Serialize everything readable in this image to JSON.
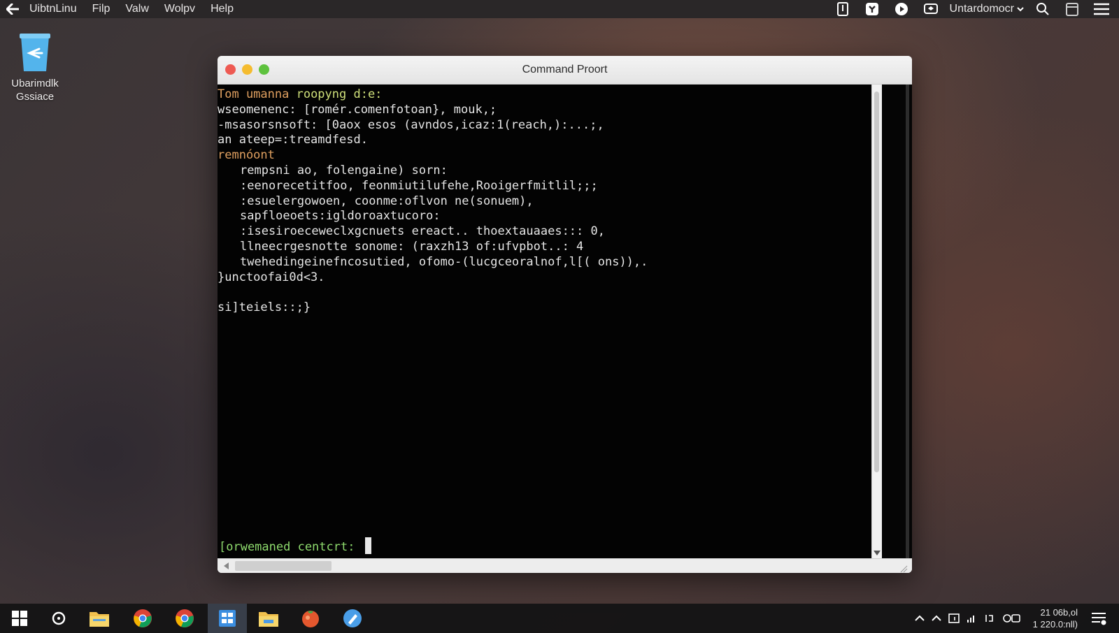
{
  "menubar": {
    "app_name": "UibtnLinu",
    "items": [
      "Filp",
      "Valw",
      "Wolpv",
      "Help"
    ],
    "user_label": "Untardomocr"
  },
  "desktop": {
    "icon_label_line1": "Ubarimdlk",
    "icon_label_line2": "Gssiace"
  },
  "window": {
    "title": "Command Proort"
  },
  "terminal": {
    "lines": [
      {
        "text": "Tom umanna ",
        "hl": "roopyng d:e:"
      },
      {
        "text": "wseomenenc: [romér.comenfotoan}, mouk,;"
      },
      {
        "text": "-msasorsnsoft: [0aox esos (avndos,icaz:1(reach,):...;,"
      },
      {
        "text": "an ateep=:treamdfesd."
      },
      {
        "text": "remnóont",
        "hl": ""
      },
      {
        "text": "rempsni ao, folengaine) sorn:"
      },
      {
        "text": ":eenorecetitfoo, feonmiutilufehe,Rooigerfmitlil;;;"
      },
      {
        "text": ":esuelergowoen, coonme:oflvon ne(sonuem),"
      },
      {
        "text": "sapfloeoets:igldoroaxtucoro:"
      },
      {
        "text": ":isesiroeceweclxgcnuets ereact.. thoextauaaes::: 0,"
      },
      {
        "text": "llneecrgesnotte sonome: (raxzh13 of:ufvpbot..: 4"
      },
      {
        "text": "twehedingeinefncosutied, ofomo-(lucgceoralnof,l[( ons)),."
      },
      {
        "text": "}unctoofai0d<3."
      },
      {
        "text": ""
      },
      {
        "text": "si]teiels::;}"
      }
    ],
    "prompt": "[orwemaned centcrt: "
  },
  "colors": {
    "prompt_green": "#8fdc6e",
    "highlight_yellow": "#cfe07a",
    "orange_text": "#e0a060"
  },
  "taskbar": {
    "clock_line1": "21 06b,ol",
    "clock_line2": "1 220.0:nll)",
    "apps": [
      "windows-start-icon",
      "refresh-icon",
      "file-explorer-icon",
      "chrome-icon",
      "chrome-icon",
      "file-manager-icon",
      "folder-icon",
      "terminal-app-icon",
      "edit-app-icon"
    ]
  }
}
